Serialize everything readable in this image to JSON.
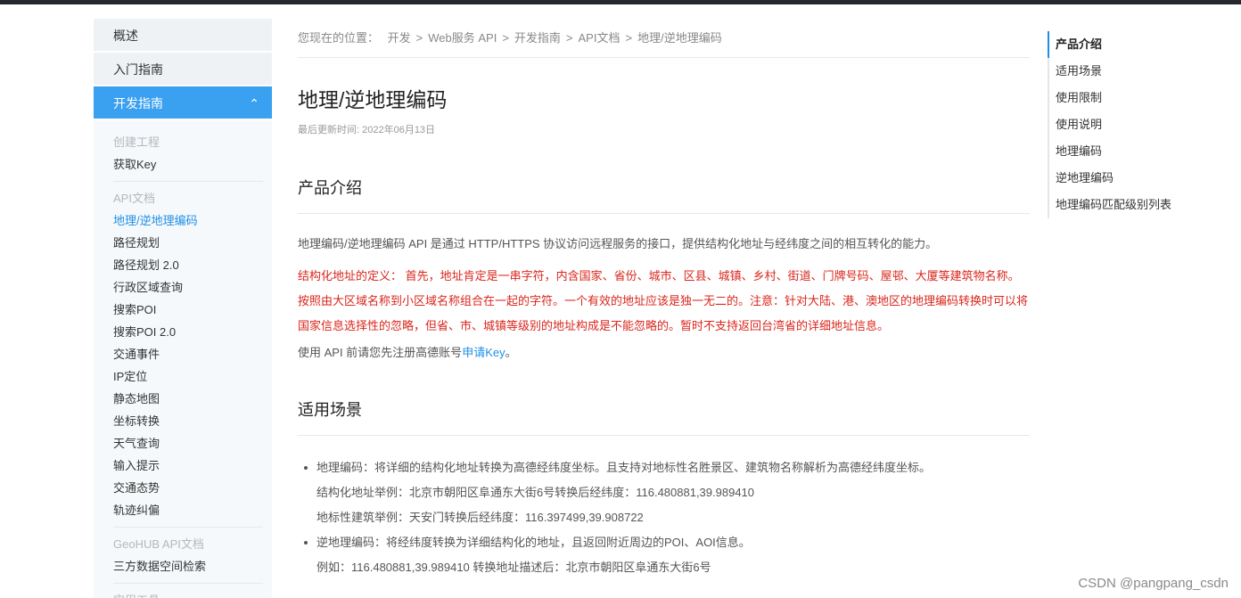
{
  "sidebar": {
    "top_items": [
      {
        "label": "概述"
      },
      {
        "label": "入门指南"
      }
    ],
    "active_section": {
      "label": "开发指南",
      "chevron": "^"
    },
    "groups": [
      {
        "title": "创建工程",
        "items": [
          "获取Key"
        ]
      },
      {
        "title": "API文档",
        "items": [
          "地理/逆地理编码",
          "路径规划",
          "路径规划 2.0",
          "行政区域查询",
          "搜索POI",
          "搜索POI 2.0",
          "交通事件",
          "IP定位",
          "静态地图",
          "坐标转换",
          "天气查询",
          "输入提示",
          "交通态势",
          "轨迹纠偏"
        ]
      },
      {
        "title": "GeoHUB API文档",
        "items": [
          "三方数据空间检索"
        ]
      },
      {
        "title": "实用工具",
        "items": []
      }
    ],
    "selected_item": "地理/逆地理编码"
  },
  "breadcrumb": {
    "prefix": "您现在的位置：",
    "path": [
      "开发",
      ">",
      "Web服务 API",
      ">",
      "开发指南",
      ">",
      "API文档",
      ">",
      "地理/逆地理编码"
    ]
  },
  "main": {
    "title": "地理/逆地理编码",
    "updated": "最后更新时间: 2022年06月13日",
    "section1": {
      "title": "产品介绍",
      "intro": "地理编码/逆地理编码 API 是通过 HTTP/HTTPS 协议访问远程服务的接口，提供结构化地址与经纬度之间的相互转化的能力。",
      "definition": "结构化地址的定义： 首先，地址肯定是一串字符，内含国家、省份、城市、区县、城镇、乡村、街道、门牌号码、屋邨、大厦等建筑物名称。按照由大区域名称到小区域名称组合在一起的字符。一个有效的地址应该是独一无二的。注意：针对大陆、港、澳地区的地理编码转换时可以将国家信息选择性的忽略，但省、市、城镇等级别的地址构成是不能忽略的。暂时不支持返回台湾省的详细地址信息。",
      "key_prefix": "使用 API 前请您先注册高德账号",
      "key_link": "申请Key",
      "key_suffix": "。"
    },
    "section2": {
      "title": "适用场景",
      "items": [
        {
          "text": "地理编码：将详细的结构化地址转换为高德经纬度坐标。且支持对地标性名胜景区、建筑物名称解析为高德经纬度坐标。",
          "subs": [
            "结构化地址举例：北京市朝阳区阜通东大街6号转换后经纬度：116.480881,39.989410",
            "地标性建筑举例：天安门转换后经纬度：116.397499,39.908722"
          ]
        },
        {
          "text": "逆地理编码：将经纬度转换为详细结构化的地址，且返回附近周边的POI、AOI信息。",
          "subs": [
            "例如：116.480881,39.989410 转换地址描述后：北京市朝阳区阜通东大街6号"
          ]
        }
      ]
    }
  },
  "toc": {
    "items": [
      "产品介绍",
      "适用场景",
      "使用限制",
      "使用说明",
      "地理编码",
      "逆地理编码",
      "地理编码匹配级别列表"
    ],
    "active": "产品介绍"
  },
  "watermark": "CSDN @pangpang_csdn",
  "colors": {
    "accent": "#1f8fe6",
    "active_bg": "#3aa0f0",
    "warning": "#d9261c"
  }
}
